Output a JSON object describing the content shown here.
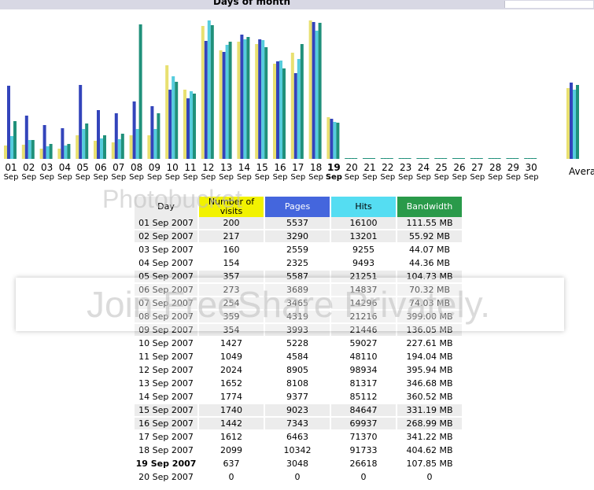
{
  "header": {
    "title": "Days of month"
  },
  "colors": {
    "visits": "#e8e070",
    "visits_light": "#f2ecb0",
    "pages": "#3344bb",
    "hits": "#55ccdd",
    "bandwidth": "#20907a"
  },
  "chart_data": {
    "type": "bar",
    "title": "Days of month",
    "series_order": [
      "visits",
      "pages",
      "hits",
      "bandwidth"
    ],
    "highlight_day": "19",
    "categories": [
      {
        "day": "01",
        "mon": "Sep"
      },
      {
        "day": "02",
        "mon": "Sep"
      },
      {
        "day": "03",
        "mon": "Sep"
      },
      {
        "day": "04",
        "mon": "Sep"
      },
      {
        "day": "05",
        "mon": "Sep"
      },
      {
        "day": "06",
        "mon": "Sep"
      },
      {
        "day": "07",
        "mon": "Sep"
      },
      {
        "day": "08",
        "mon": "Sep"
      },
      {
        "day": "09",
        "mon": "Sep"
      },
      {
        "day": "10",
        "mon": "Sep"
      },
      {
        "day": "11",
        "mon": "Sep"
      },
      {
        "day": "12",
        "mon": "Sep"
      },
      {
        "day": "13",
        "mon": "Sep"
      },
      {
        "day": "14",
        "mon": "Sep"
      },
      {
        "day": "15",
        "mon": "Sep"
      },
      {
        "day": "16",
        "mon": "Sep"
      },
      {
        "day": "17",
        "mon": "Sep"
      },
      {
        "day": "18",
        "mon": "Sep"
      },
      {
        "day": "19",
        "mon": "Sep"
      },
      {
        "day": "20",
        "mon": "Sep"
      },
      {
        "day": "21",
        "mon": "Sep"
      },
      {
        "day": "22",
        "mon": "Sep"
      },
      {
        "day": "23",
        "mon": "Sep"
      },
      {
        "day": "24",
        "mon": "Sep"
      },
      {
        "day": "25",
        "mon": "Sep"
      },
      {
        "day": "26",
        "mon": "Sep"
      },
      {
        "day": "27",
        "mon": "Sep"
      },
      {
        "day": "28",
        "mon": "Sep"
      },
      {
        "day": "29",
        "mon": "Sep"
      },
      {
        "day": "30",
        "mon": "Sep"
      }
    ],
    "visits": [
      200,
      217,
      160,
      154,
      357,
      273,
      254,
      359,
      354,
      1427,
      1049,
      2024,
      1652,
      1774,
      1740,
      1442,
      1612,
      2099,
      637,
      0,
      0,
      0,
      0,
      0,
      0,
      0,
      0,
      0,
      0,
      0
    ],
    "pages": [
      5537,
      3290,
      2559,
      2325,
      5587,
      3689,
      3465,
      4319,
      3993,
      5228,
      4584,
      8905,
      8108,
      9377,
      9023,
      7343,
      6463,
      10342,
      3048,
      0,
      0,
      0,
      0,
      0,
      0,
      0,
      0,
      0,
      0,
      0
    ],
    "hits": [
      16100,
      13201,
      9255,
      9493,
      21251,
      14837,
      14296,
      21216,
      21446,
      59027,
      48110,
      98934,
      81317,
      85112,
      84647,
      69937,
      71370,
      91733,
      26618,
      0,
      0,
      0,
      0,
      0,
      0,
      0,
      0,
      0,
      0,
      0
    ],
    "bandwidth": [
      111.55,
      55.92,
      44.07,
      44.36,
      104.73,
      70.32,
      74.03,
      399.0,
      136.05,
      227.61,
      194.04,
      395.94,
      346.68,
      360.52,
      331.19,
      268.99,
      341.22,
      404.62,
      107.85,
      0,
      0,
      0,
      0,
      0,
      0,
      0,
      0,
      0,
      0,
      0
    ],
    "average": {
      "label": "Averag",
      "visits": 1079,
      "pages": 5770,
      "hits": 49355,
      "bandwidth": 219.67
    },
    "bandwidth_unit": "MB"
  },
  "table": {
    "headers": {
      "day": "Day",
      "visits": "Number of visits",
      "pages": "Pages",
      "hits": "Hits",
      "bandwidth": "Bandwidth"
    },
    "rows": [
      {
        "day": "01 Sep 2007",
        "visits": "200",
        "pages": "5537",
        "hits": "16100",
        "bandwidth": "111.55 MB"
      },
      {
        "day": "02 Sep 2007",
        "visits": "217",
        "pages": "3290",
        "hits": "13201",
        "bandwidth": "55.92 MB"
      },
      {
        "day": "03 Sep 2007",
        "visits": "160",
        "pages": "2559",
        "hits": "9255",
        "bandwidth": "44.07 MB"
      },
      {
        "day": "04 Sep 2007",
        "visits": "154",
        "pages": "2325",
        "hits": "9493",
        "bandwidth": "44.36 MB"
      },
      {
        "day": "05 Sep 2007",
        "visits": "357",
        "pages": "5587",
        "hits": "21251",
        "bandwidth": "104.73 MB"
      },
      {
        "day": "06 Sep 2007",
        "visits": "273",
        "pages": "3689",
        "hits": "14837",
        "bandwidth": "70.32 MB"
      },
      {
        "day": "07 Sep 2007",
        "visits": "254",
        "pages": "3465",
        "hits": "14296",
        "bandwidth": "74.03 MB"
      },
      {
        "day": "08 Sep 2007",
        "visits": "359",
        "pages": "4319",
        "hits": "21216",
        "bandwidth": "399.00 MB"
      },
      {
        "day": "09 Sep 2007",
        "visits": "354",
        "pages": "3993",
        "hits": "21446",
        "bandwidth": "136.05 MB"
      },
      {
        "day": "10 Sep 2007",
        "visits": "1427",
        "pages": "5228",
        "hits": "59027",
        "bandwidth": "227.61 MB"
      },
      {
        "day": "11 Sep 2007",
        "visits": "1049",
        "pages": "4584",
        "hits": "48110",
        "bandwidth": "194.04 MB"
      },
      {
        "day": "12 Sep 2007",
        "visits": "2024",
        "pages": "8905",
        "hits": "98934",
        "bandwidth": "395.94 MB"
      },
      {
        "day": "13 Sep 2007",
        "visits": "1652",
        "pages": "8108",
        "hits": "81317",
        "bandwidth": "346.68 MB"
      },
      {
        "day": "14 Sep 2007",
        "visits": "1774",
        "pages": "9377",
        "hits": "85112",
        "bandwidth": "360.52 MB"
      },
      {
        "day": "15 Sep 2007",
        "visits": "1740",
        "pages": "9023",
        "hits": "84647",
        "bandwidth": "331.19 MB"
      },
      {
        "day": "16 Sep 2007",
        "visits": "1442",
        "pages": "7343",
        "hits": "69937",
        "bandwidth": "268.99 MB"
      },
      {
        "day": "17 Sep 2007",
        "visits": "1612",
        "pages": "6463",
        "hits": "71370",
        "bandwidth": "341.22 MB"
      },
      {
        "day": "18 Sep 2007",
        "visits": "2099",
        "pages": "10342",
        "hits": "91733",
        "bandwidth": "404.62 MB"
      },
      {
        "day": "19 Sep 2007",
        "visits": "637",
        "pages": "3048",
        "hits": "26618",
        "bandwidth": "107.85 MB"
      },
      {
        "day": "20 Sep 2007",
        "visits": "0",
        "pages": "0",
        "hits": "0",
        "bandwidth": "0"
      }
    ],
    "shaded_rows": [
      0,
      1,
      4,
      5,
      6,
      7,
      8,
      14,
      15
    ],
    "bold_row": 18
  },
  "watermark": {
    "line1": "Photobucket",
    "line2": "Join FreeShare Privately."
  }
}
